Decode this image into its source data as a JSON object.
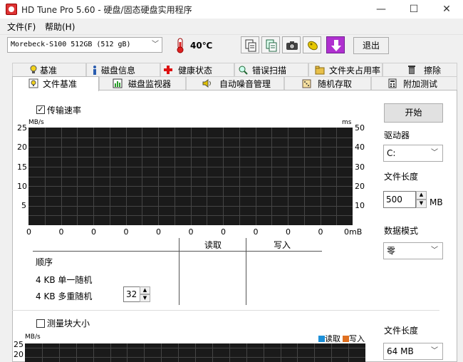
{
  "window": {
    "title": "HD Tune Pro 5.60 - 硬盘/固态硬盘实用程序",
    "minimize": "—",
    "maximize": "☐",
    "close": "✕"
  },
  "menu": {
    "file": "文件(F)",
    "help": "帮助(H)"
  },
  "toolbar": {
    "drive": "Morebeck-S100  512GB (512 gB)",
    "temperature": "40℃",
    "exit": "退出",
    "icons": [
      "thermometer-icon",
      "copy-icon",
      "copy-all-icon",
      "camera-icon",
      "info-icon",
      "download-icon"
    ]
  },
  "tabs_top": [
    {
      "label": "基准",
      "icon": "bulb-icon"
    },
    {
      "label": "磁盘信息",
      "icon": "info-i-icon"
    },
    {
      "label": "健康状态",
      "icon": "health-cross-icon"
    },
    {
      "label": "错误扫描",
      "icon": "magnifier-icon"
    },
    {
      "label": "文件夹占用率",
      "icon": "folder-icon"
    },
    {
      "label": "擦除",
      "icon": "trash-icon"
    }
  ],
  "tabs_bottom": [
    {
      "label": "文件基准",
      "icon": "file-bulb-icon"
    },
    {
      "label": "磁盘监视器",
      "icon": "chart-bars-icon"
    },
    {
      "label": "自动噪音管理",
      "icon": "speaker-icon"
    },
    {
      "label": "随机存取",
      "icon": "dice-icon"
    },
    {
      "label": "附加测试",
      "icon": "calculator-icon"
    }
  ],
  "benchmark": {
    "transfer_checkbox": "传输速率",
    "transfer_checked": "✓",
    "left_unit": "MB/s",
    "right_unit": "ms",
    "left_ticks": [
      "25",
      "20",
      "15",
      "10",
      "5"
    ],
    "right_ticks": [
      "50",
      "40",
      "30",
      "20",
      "10"
    ],
    "x_ticks": [
      "0",
      "0",
      "0",
      "0",
      "0",
      "0",
      "0",
      "0",
      "0",
      "0",
      "0mB"
    ],
    "table": {
      "col_read": "读取",
      "col_write": "写入",
      "rows": [
        "顺序",
        "4 KB 单一随机",
        "4 KB 多重随机"
      ]
    },
    "queue_depth": "32",
    "block_checkbox": "测量块大小",
    "block_unit": "MB/s",
    "block_ticks": [
      "25",
      "20"
    ],
    "legend_read": "读取",
    "legend_write": "写入",
    "legend_read_color": "#1e90d8",
    "legend_write_color": "#e07020"
  },
  "side": {
    "start": "开始",
    "drive_label": "驱动器",
    "drive_value": "C:",
    "filelen_label": "文件长度",
    "filelen_value": "500",
    "filelen_unit": "MB",
    "datamode_label": "数据模式",
    "datamode_value": "零",
    "filelen2_label": "文件长度",
    "filelen2_value": "64 MB"
  }
}
